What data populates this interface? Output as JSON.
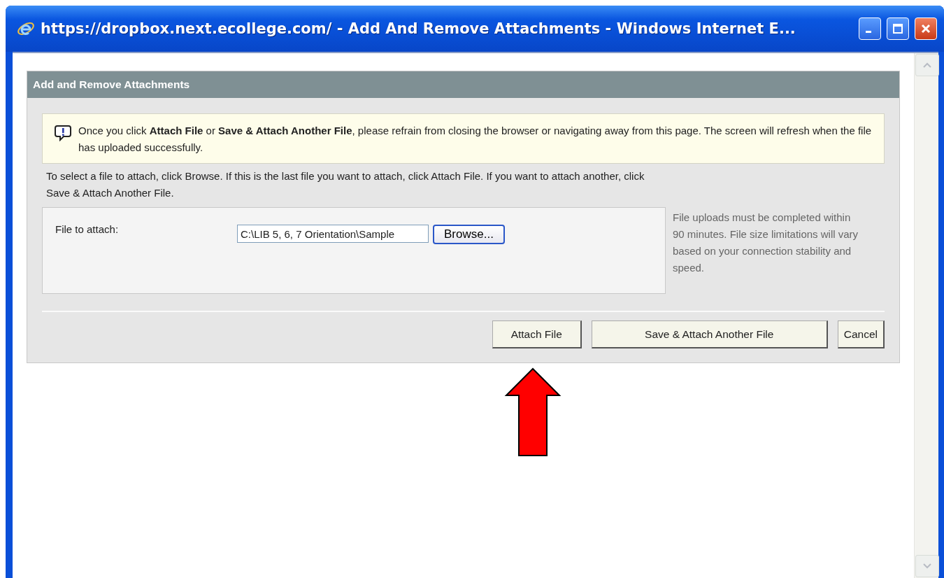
{
  "window": {
    "title": "https://dropbox.next.ecollege.com/ - Add And Remove Attachments - Windows Internet E..."
  },
  "panel": {
    "title": "Add and Remove Attachments",
    "notice": "Once you click **Attach File** or **Save & Attach Another File**, please refrain from closing the browser or navigating away from this page. The screen will refresh when the file has uploaded successfully.",
    "instructions": "To select a file to attach, click Browse. If this is the last file you want to attach, click Attach File. If you want to attach another, click Save & Attach Another File.",
    "file_label": "File to attach:",
    "file_value": "C:\\LIB 5, 6, 7 Orientation\\Sample",
    "browse_button": "Browse...",
    "side_note": "File uploads must be completed within 90 minutes. File size limitations will vary based on your connection stability and speed.",
    "buttons": [
      {
        "label": "Attach File",
        "kind": "attach"
      },
      {
        "label": "Save & Attach Another File",
        "kind": "save"
      },
      {
        "label": "Cancel",
        "kind": "cancel"
      }
    ]
  }
}
